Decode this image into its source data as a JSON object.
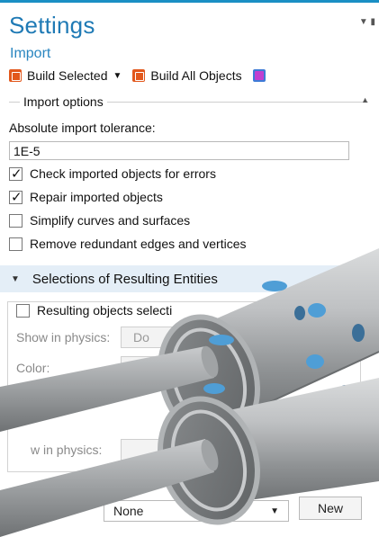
{
  "panel": {
    "title": "Settings",
    "subtitle": "Import"
  },
  "toolbar": {
    "build_selected": "Build Selected",
    "build_all": "Build All Objects"
  },
  "import_options": {
    "group_label": "Import options",
    "tolerance_label": "Absolute import tolerance:",
    "tolerance_value": "1E-5",
    "checks": [
      {
        "label": "Check imported objects for errors",
        "checked": true
      },
      {
        "label": "Repair imported objects",
        "checked": true
      },
      {
        "label": "Simplify curves and surfaces",
        "checked": false
      },
      {
        "label": "Remove redundant edges and vertices",
        "checked": false
      }
    ]
  },
  "selections": {
    "header": "Selections of Resulting Entities",
    "resulting_label": "Resulting objects selecti",
    "show_in_physics_1": "Show in physics:",
    "dropdown_partial": "Do",
    "color_label": "Color:",
    "show_in_physics_2": "w in physics:"
  },
  "bottom": {
    "select_value": "None",
    "new_button": "New"
  },
  "colors": {
    "title": "#1f7ab5",
    "section_bg": "#e4eef7",
    "accent_top": "#1a8fc4",
    "tube_grey": "#a9acae",
    "hole_blue": "#4f9ed6"
  }
}
